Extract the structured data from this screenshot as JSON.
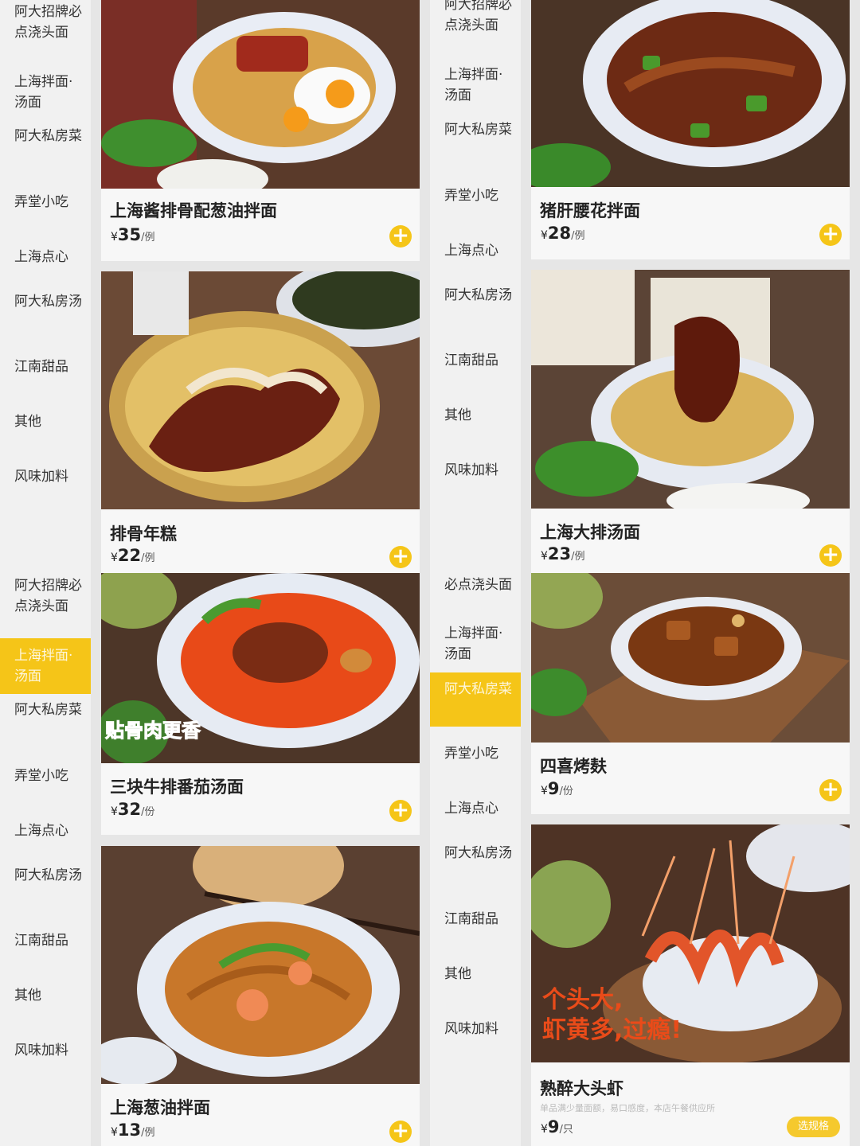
{
  "colors": {
    "accent": "#f5c518",
    "sidebar_bg": "#f1f1f1",
    "card_bg": "#f7f7f7",
    "text": "#222222"
  },
  "icons": {
    "add": "plus-circle-icon"
  },
  "currency": "¥",
  "q_tl": {
    "nav": [
      "阿大招牌必点浇头面",
      "上海拌面·汤面",
      "阿大私房菜",
      "弄堂小吃",
      "上海点心",
      "阿大私房汤",
      "江南甜品",
      "其他",
      "风味加料"
    ],
    "cards": [
      {
        "title": "上海酱排骨配葱油拌面",
        "price": "35",
        "unit": "/例"
      },
      {
        "title": "排骨年糕",
        "price": "22",
        "unit": "/例"
      }
    ]
  },
  "q_tr": {
    "nav": [
      "阿大招牌必点浇头面",
      "上海拌面·汤面",
      "阿大私房菜",
      "弄堂小吃",
      "上海点心",
      "阿大私房汤",
      "江南甜品",
      "其他",
      "风味加料"
    ],
    "cards": [
      {
        "title": "猪肝腰花拌面",
        "price": "28",
        "unit": "/例"
      },
      {
        "title": "上海大排汤面",
        "price": "23",
        "unit": "/例"
      }
    ]
  },
  "q_bl": {
    "nav": [
      "阿大招牌必点浇头面",
      "上海拌面·汤面",
      "阿大私房菜",
      "弄堂小吃",
      "上海点心",
      "阿大私房汤",
      "江南甜品",
      "其他",
      "风味加料"
    ],
    "active_nav": "上海拌面·汤面",
    "cards": [
      {
        "title": "三块牛排番茄汤面",
        "price": "32",
        "unit": "/份",
        "overlay": "贴骨肉更香"
      },
      {
        "title": "上海葱油拌面",
        "price": "13",
        "unit": "/例"
      }
    ]
  },
  "q_br": {
    "nav": [
      "必点浇头面",
      "上海拌面·汤面",
      "阿大私房菜",
      "弄堂小吃",
      "上海点心",
      "阿大私房汤",
      "江南甜品",
      "其他",
      "风味加料"
    ],
    "active_nav": "阿大私房菜",
    "cards": [
      {
        "title": "四喜烤麸",
        "price": "9",
        "unit": "/份"
      },
      {
        "title": "熟醉大头虾",
        "price": "9",
        "unit": "/只",
        "subtitle": "单品满少量面额，易口感度，本店午餐供应所",
        "overlay_line1": "个头大,",
        "overlay_line2": "虾黄多,过瘾!",
        "pill": "选规格"
      }
    ]
  }
}
